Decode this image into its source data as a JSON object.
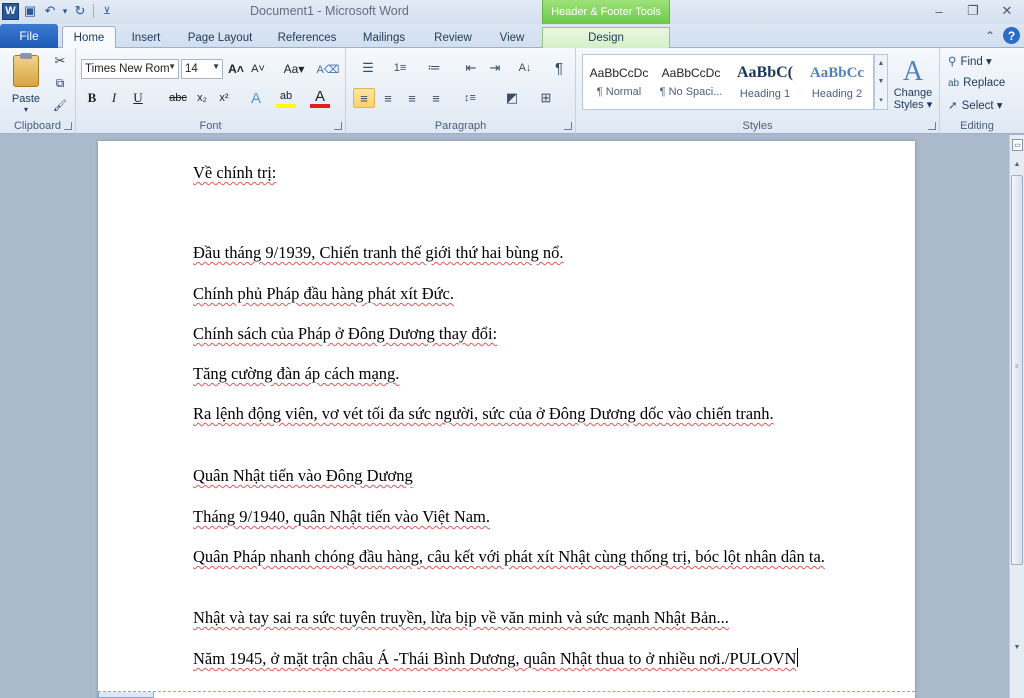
{
  "window": {
    "title": "Document1 - Microsoft Word",
    "app_icon": "W",
    "controls": {
      "minimize": "–",
      "restore": "❐",
      "close": "✕"
    }
  },
  "qat": {
    "save_icon": "▣",
    "undo_icon": "↶",
    "undo_dropdown": "▾",
    "redo_icon": "↻",
    "customize_icon": "⊻"
  },
  "contextual_tab_header": "Header & Footer Tools",
  "tabs": {
    "file": "File",
    "items": [
      "Home",
      "Insert",
      "Page Layout",
      "References",
      "Mailings",
      "Review",
      "View",
      "Design"
    ],
    "active": "Home",
    "collapse_icon": "⌃",
    "help_icon": "?"
  },
  "clipboard": {
    "label": "Clipboard",
    "paste": "Paste",
    "paste_arrow": "▾",
    "cut_icon": "✂",
    "copy_icon": "⧉",
    "format_painter_icon": "🖌"
  },
  "font": {
    "label": "Font",
    "name": "Times New Rom",
    "size": "14",
    "grow": "A˄",
    "shrink": "A˅",
    "change_case": "Aa▾",
    "clear_format": "A⌫",
    "bold": "B",
    "italic": "I",
    "underline": "U",
    "strikethrough": "abc",
    "subscript": "x₂",
    "superscript": "x²",
    "text_effects": "A",
    "highlight": "ab",
    "font_color": "A",
    "highlight_color": "#ffff00",
    "font_color_value": "#e02020"
  },
  "paragraph": {
    "label": "Paragraph",
    "bullets": "☰",
    "numbering": "1≡",
    "multilevel": "≔",
    "decrease_indent": "⇤",
    "increase_indent": "⇥",
    "sort": "A↓",
    "show_marks": "¶",
    "align_left": "≡",
    "center": "≡",
    "align_right": "≡",
    "justify": "≡",
    "line_spacing": "↕≡",
    "shading": "◩",
    "borders": "⊞"
  },
  "styles": {
    "label": "Styles",
    "items": [
      {
        "sample": "AaBbCcDc",
        "name": "¶ Normal"
      },
      {
        "sample": "AaBbCcDc",
        "name": "¶ No Spaci..."
      },
      {
        "sample": "AaBbC(",
        "name": "Heading 1"
      },
      {
        "sample": "AaBbCc",
        "name": "Heading 2"
      }
    ],
    "change_styles": "Change Styles ▾",
    "change_styles_icon": "A"
  },
  "editing": {
    "label": "Editing",
    "find": "Find ▾",
    "replace": "Replace",
    "select": "Select ▾"
  },
  "document": {
    "paragraphs": [
      "Về chính trị:",
      "Đầu tháng 9/1939, Chiến tranh thế giới thứ hai bùng nổ.",
      "Chính phủ Pháp đầu hàng phát xít Đức.",
      "Chính sách của Pháp ở Đông Dương thay đổi:",
      "Tăng cường đàn áp cách mạng.",
      "Ra lệnh động viên, vơ vét tối đa sức người, sức của ở Đông Dương dốc vào chiến tranh.",
      "Quân Nhật tiến vào Đông Dương",
      "Tháng 9/1940, quân Nhật tiến vào Việt Nam.",
      "Quân Pháp nhanh chóng đầu hàng, câu kết với phát xít Nhật cùng thống trị, bóc lột nhân dân ta.",
      "Nhật và tay sai ra sức tuyên truyền, lừa bịp về văn minh và sức mạnh Nhật Bản...",
      "Năm 1945, ở mặt trận châu Á -Thái Bình Dương, quân Nhật thua to ở nhiều nơi./PULOVN"
    ]
  }
}
